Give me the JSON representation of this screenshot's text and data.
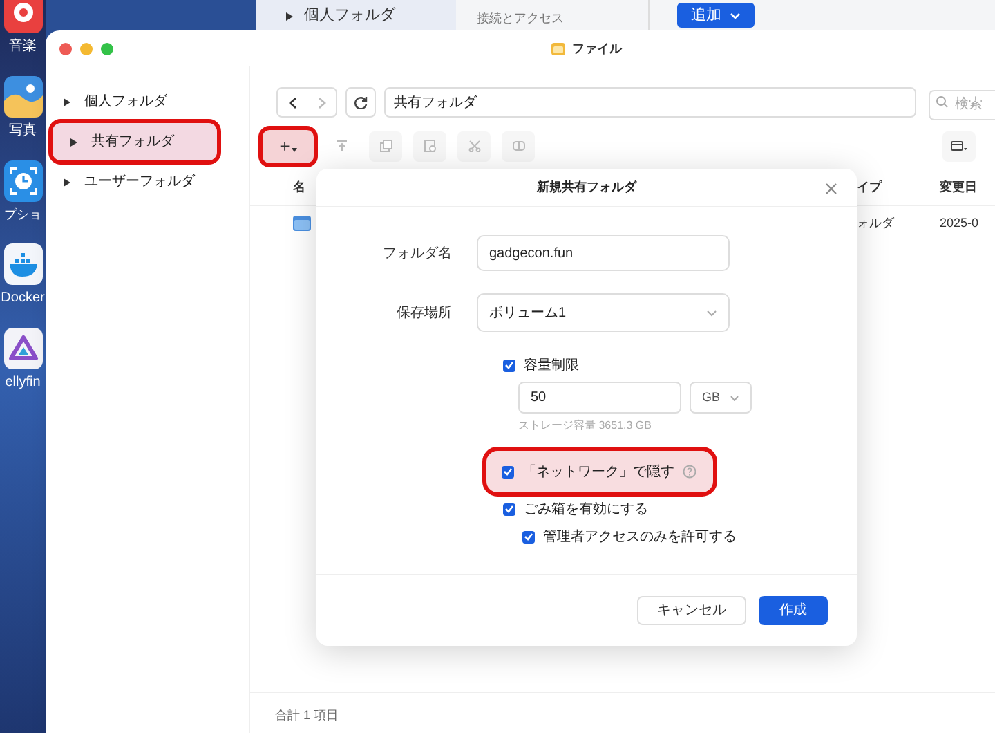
{
  "dock": [
    {
      "label": "音楽",
      "kind": "music"
    },
    {
      "label": "写真",
      "kind": "photos"
    },
    {
      "label": "プショ",
      "kind": "snapshot"
    },
    {
      "label": "Docker",
      "kind": "docker"
    },
    {
      "label": "ellyfin",
      "kind": "jellyfin"
    }
  ],
  "background_window": {
    "sidebar_item": "個人フォルダ",
    "section": "接続とアクセス",
    "add_button": "追加"
  },
  "window": {
    "title": "ファイル"
  },
  "sidebar": {
    "items": [
      {
        "label": "個人フォルダ",
        "selected": false,
        "annotated": false
      },
      {
        "label": "共有フォルダ",
        "selected": true,
        "annotated": true
      },
      {
        "label": "ユーザーフォルダ",
        "selected": false,
        "annotated": false
      }
    ]
  },
  "toolbar": {
    "path": "共有フォルダ",
    "search_placeholder": "検索",
    "add_button": {
      "label": "+",
      "annotated": true
    }
  },
  "table": {
    "columns": [
      "名",
      "イプ",
      "変更日"
    ],
    "rows": [
      {
        "type": "ォルダ",
        "modified": "2025-0"
      }
    ]
  },
  "status_bar": "合計 1 項目",
  "dialog": {
    "title": "新規共有フォルダ",
    "name_label": "フォルダ名",
    "name_value": "gadgecon.fun",
    "location_label": "保存場所",
    "location_value": "ボリューム1",
    "options": [
      {
        "label": "容量制限",
        "checked": true,
        "annotated": false,
        "help": false
      },
      {
        "label": "「ネットワーク」で隠す",
        "checked": true,
        "annotated": true,
        "help": true
      },
      {
        "label": "ごみ箱を有効にする",
        "checked": true,
        "annotated": false,
        "help": false,
        "children": [
          {
            "label": "管理者アクセスのみを許可する",
            "checked": true,
            "annotated": false,
            "help": false
          }
        ]
      }
    ],
    "quota_value": "50",
    "quota_unit": "GB",
    "quota_hint": "ストレージ容量 3651.3 GB",
    "buttons": [
      {
        "label": "キャンセル",
        "kind": "secondary"
      },
      {
        "label": "作成",
        "kind": "primary"
      }
    ]
  }
}
